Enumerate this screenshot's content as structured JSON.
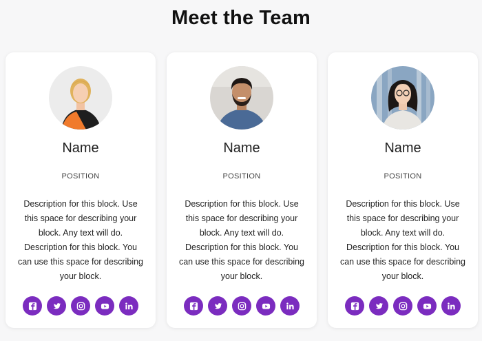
{
  "page": {
    "title": "Meet the Team"
  },
  "colors": {
    "accent": "#7b2cbf",
    "card_bg": "#ffffff",
    "page_bg": "#f7f7f8"
  },
  "members": [
    {
      "name": "Name",
      "position": "POSITION",
      "description": "Description for this block. Use this space for describing your block. Any text will do. Description for this block. You can use this space for describing your block.",
      "avatar": "woman-blonde-orange-top-photo"
    },
    {
      "name": "Name",
      "position": "POSITION",
      "description": "Description for this block. Use this space for describing your block. Any text will do. Description for this block. You can use this space for describing your block.",
      "avatar": "man-beard-blue-shirt-photo"
    },
    {
      "name": "Name",
      "position": "POSITION",
      "description": "Description for this block. Use this space for describing your block. Any text will do. Description for this block. You can use this space for describing your block.",
      "avatar": "woman-dark-hair-glasses-photo"
    }
  ],
  "social_icons": [
    "facebook-icon",
    "twitter-icon",
    "instagram-icon",
    "youtube-icon",
    "linkedin-icon"
  ]
}
